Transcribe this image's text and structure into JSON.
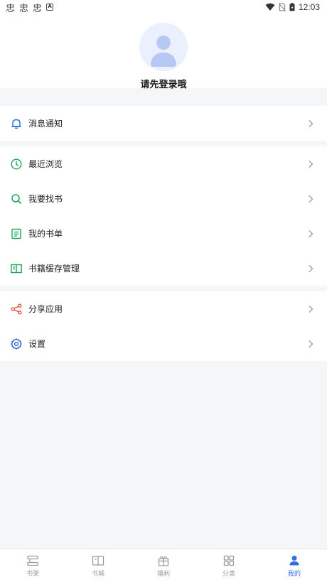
{
  "status_bar": {
    "left_glyphs": [
      "忠",
      "忠",
      "忠"
    ],
    "left_badge": "A",
    "time": "12:03"
  },
  "profile": {
    "login_prompt": "请先登录哦"
  },
  "menu": {
    "group1": [
      {
        "label": "消息通知",
        "icon": "bell-icon",
        "color": "#1f6fe0"
      }
    ],
    "group2": [
      {
        "label": "最近浏览",
        "icon": "clock-icon",
        "color": "#1aa55a"
      },
      {
        "label": "我要找书",
        "icon": "search-icon",
        "color": "#1aa55a"
      },
      {
        "label": "我的书单",
        "icon": "list-icon",
        "color": "#1aa55a"
      },
      {
        "label": "书籍缓存管理",
        "icon": "book-open-icon",
        "color": "#1aa55a"
      }
    ],
    "group3": [
      {
        "label": "分享应用",
        "icon": "share-icon",
        "color": "#e0462c"
      },
      {
        "label": "设置",
        "icon": "gear-icon",
        "color": "#2550c8"
      }
    ]
  },
  "tabbar": {
    "tabs": [
      {
        "label": "书架",
        "icon": "bookshelf-icon",
        "active": false
      },
      {
        "label": "书城",
        "icon": "book-icon",
        "active": false
      },
      {
        "label": "福利",
        "icon": "gift-icon",
        "active": false
      },
      {
        "label": "分类",
        "icon": "grid-icon",
        "active": false
      },
      {
        "label": "我的",
        "icon": "user-icon",
        "active": true
      }
    ],
    "active_color": "#2f6fe6",
    "inactive_color": "#9a9a9a"
  }
}
